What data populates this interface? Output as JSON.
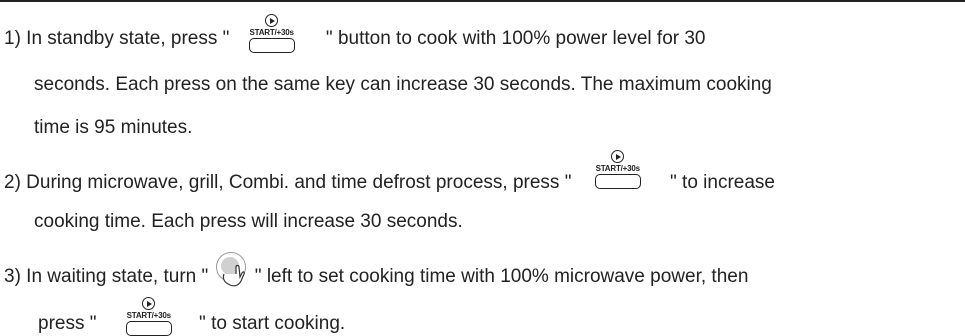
{
  "icons": {
    "start_button_label": "START/+30s",
    "start_button_icon": "play-circle-icon",
    "dial_icon": "hand-turning-dial-icon"
  },
  "items": [
    {
      "prefix": "1) In standby state, press \"",
      "suffix": "\" button to cook with 100% power level for 30",
      "line2": "seconds. Each press on the same key can increase 30 seconds. The maximum cooking",
      "line3": "time is 95 minutes."
    },
    {
      "prefix": "2) During microwave, grill, Combi. and time defrost process, press \"",
      "suffix": "\" to increase",
      "line2": "cooking time. Each press will increase 30 seconds."
    },
    {
      "prefix": "3) In waiting state, turn \"",
      "suffix": "\"  left to set cooking time with 100% microwave power, then",
      "line2_prefix": "press \"",
      "line2_suffix": "\" to start cooking."
    }
  ]
}
